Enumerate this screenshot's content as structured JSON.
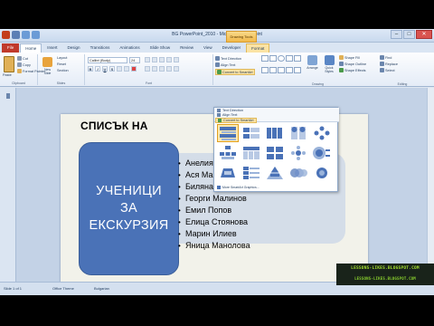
{
  "window": {
    "title": "BG PowerPoint_2010 - Microsoft PowerPoint",
    "contextual_tab": "Drawing Tools",
    "controls": [
      "–",
      "□",
      "✕"
    ]
  },
  "tabs": [
    "File",
    "Home",
    "Insert",
    "Design",
    "Transitions",
    "Animations",
    "Slide Show",
    "Review",
    "View",
    "Developer",
    "Format"
  ],
  "active_tab": "Home",
  "ribbon": {
    "clipboard": {
      "paste": "Paste",
      "cut": "Cut",
      "copy": "Copy",
      "format_painter": "Format Painter",
      "label": "Clipboard"
    },
    "slides": {
      "new_slide": "New Slide",
      "layout": "Layout",
      "reset": "Reset",
      "section": "Section",
      "label": "Slides"
    },
    "font": {
      "family": "Calibri (Body)",
      "size": "24",
      "bold": "B",
      "italic": "I",
      "underline": "U",
      "strike": "S",
      "label": "Font"
    },
    "paragraph": {
      "text_direction": "Text Direction",
      "align_text": "Align Text",
      "convert": "Convert to SmartArt",
      "label": "Paragraph"
    },
    "drawing": {
      "arrange": "Arrange",
      "quick_styles": "Quick Styles",
      "shape_fill": "Shape Fill",
      "shape_outline": "Shape Outline",
      "shape_effects": "Shape Effects",
      "label": "Drawing"
    },
    "editing": {
      "find": "Find",
      "replace": "Replace",
      "select": "Select",
      "label": "Editing"
    }
  },
  "slide": {
    "title": "СПИСЪК НА",
    "box_lines": [
      "УЧЕНИЦИ",
      "ЗА",
      "ЕКСКУРЗИЯ"
    ],
    "names": [
      "Анелия",
      "Ася Ма",
      "Биляна",
      "Георги Малинов",
      "Емил Попов",
      "Елица Стоянова",
      "Марин Илиев",
      "Яница Манолова"
    ]
  },
  "smartart_dropdown": {
    "more_label": "More SmartArt Graphics..."
  },
  "status": {
    "slide": "Slide 1 of 1",
    "theme": "Office Theme",
    "language": "Bulgarian"
  },
  "watermark": {
    "line1": "LESSONS-LIKES.BLOGSPOT.COM",
    "line2": "LESSONS-LIKES.BLOGSPOT.COM"
  },
  "colors": {
    "accent": "#4a72b7",
    "file_tab": "#c0392b",
    "highlight": "#fde9b0"
  }
}
